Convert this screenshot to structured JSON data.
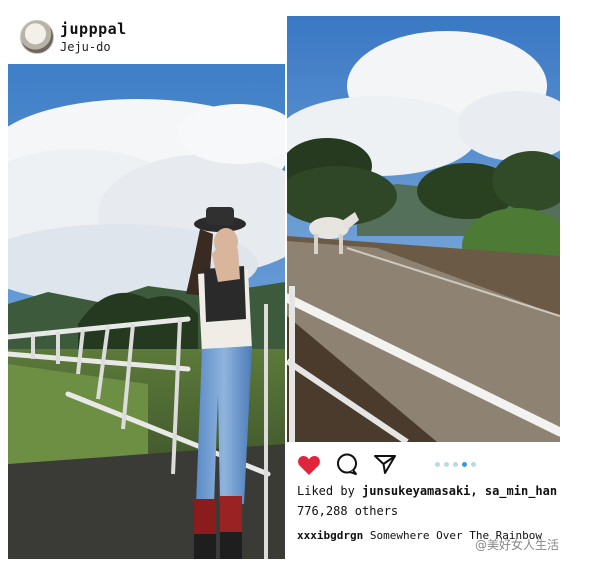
{
  "left_post": {
    "username": "jupppal",
    "location": "Jeju-do"
  },
  "right_post": {
    "liked_by_prefix": "Liked by ",
    "liked_by_users": "junsukeyamasaki, sa_min_han",
    "likes_count": "776,288 others",
    "caption_user": "xxxibgdrgn",
    "caption_text": " Somewhere Over The Rainbow",
    "carousel": {
      "total": 5,
      "active_index": 3
    }
  },
  "icons": [
    "heart-icon",
    "comment-icon",
    "share-icon",
    "carousel-dots"
  ],
  "colors": {
    "heart": "#e0243c",
    "dot_active": "#3d97d8",
    "dot_inactive": "#bcd8e0"
  },
  "watermark": "@美好女人生活"
}
